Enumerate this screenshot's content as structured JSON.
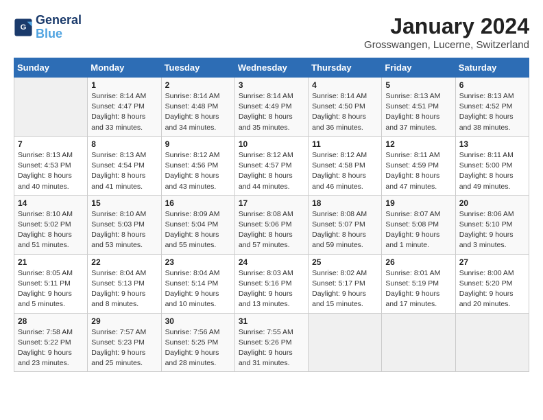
{
  "logo": {
    "line1": "General",
    "line2": "Blue"
  },
  "title": "January 2024",
  "subtitle": "Grosswangen, Lucerne, Switzerland",
  "days_of_week": [
    "Sunday",
    "Monday",
    "Tuesday",
    "Wednesday",
    "Thursday",
    "Friday",
    "Saturday"
  ],
  "weeks": [
    [
      {
        "day": "",
        "info": ""
      },
      {
        "day": "1",
        "info": "Sunrise: 8:14 AM\nSunset: 4:47 PM\nDaylight: 8 hours\nand 33 minutes."
      },
      {
        "day": "2",
        "info": "Sunrise: 8:14 AM\nSunset: 4:48 PM\nDaylight: 8 hours\nand 34 minutes."
      },
      {
        "day": "3",
        "info": "Sunrise: 8:14 AM\nSunset: 4:49 PM\nDaylight: 8 hours\nand 35 minutes."
      },
      {
        "day": "4",
        "info": "Sunrise: 8:14 AM\nSunset: 4:50 PM\nDaylight: 8 hours\nand 36 minutes."
      },
      {
        "day": "5",
        "info": "Sunrise: 8:13 AM\nSunset: 4:51 PM\nDaylight: 8 hours\nand 37 minutes."
      },
      {
        "day": "6",
        "info": "Sunrise: 8:13 AM\nSunset: 4:52 PM\nDaylight: 8 hours\nand 38 minutes."
      }
    ],
    [
      {
        "day": "7",
        "info": "Sunrise: 8:13 AM\nSunset: 4:53 PM\nDaylight: 8 hours\nand 40 minutes."
      },
      {
        "day": "8",
        "info": "Sunrise: 8:13 AM\nSunset: 4:54 PM\nDaylight: 8 hours\nand 41 minutes."
      },
      {
        "day": "9",
        "info": "Sunrise: 8:12 AM\nSunset: 4:56 PM\nDaylight: 8 hours\nand 43 minutes."
      },
      {
        "day": "10",
        "info": "Sunrise: 8:12 AM\nSunset: 4:57 PM\nDaylight: 8 hours\nand 44 minutes."
      },
      {
        "day": "11",
        "info": "Sunrise: 8:12 AM\nSunset: 4:58 PM\nDaylight: 8 hours\nand 46 minutes."
      },
      {
        "day": "12",
        "info": "Sunrise: 8:11 AM\nSunset: 4:59 PM\nDaylight: 8 hours\nand 47 minutes."
      },
      {
        "day": "13",
        "info": "Sunrise: 8:11 AM\nSunset: 5:00 PM\nDaylight: 8 hours\nand 49 minutes."
      }
    ],
    [
      {
        "day": "14",
        "info": "Sunrise: 8:10 AM\nSunset: 5:02 PM\nDaylight: 8 hours\nand 51 minutes."
      },
      {
        "day": "15",
        "info": "Sunrise: 8:10 AM\nSunset: 5:03 PM\nDaylight: 8 hours\nand 53 minutes."
      },
      {
        "day": "16",
        "info": "Sunrise: 8:09 AM\nSunset: 5:04 PM\nDaylight: 8 hours\nand 55 minutes."
      },
      {
        "day": "17",
        "info": "Sunrise: 8:08 AM\nSunset: 5:06 PM\nDaylight: 8 hours\nand 57 minutes."
      },
      {
        "day": "18",
        "info": "Sunrise: 8:08 AM\nSunset: 5:07 PM\nDaylight: 8 hours\nand 59 minutes."
      },
      {
        "day": "19",
        "info": "Sunrise: 8:07 AM\nSunset: 5:08 PM\nDaylight: 9 hours\nand 1 minute."
      },
      {
        "day": "20",
        "info": "Sunrise: 8:06 AM\nSunset: 5:10 PM\nDaylight: 9 hours\nand 3 minutes."
      }
    ],
    [
      {
        "day": "21",
        "info": "Sunrise: 8:05 AM\nSunset: 5:11 PM\nDaylight: 9 hours\nand 5 minutes."
      },
      {
        "day": "22",
        "info": "Sunrise: 8:04 AM\nSunset: 5:13 PM\nDaylight: 9 hours\nand 8 minutes."
      },
      {
        "day": "23",
        "info": "Sunrise: 8:04 AM\nSunset: 5:14 PM\nDaylight: 9 hours\nand 10 minutes."
      },
      {
        "day": "24",
        "info": "Sunrise: 8:03 AM\nSunset: 5:16 PM\nDaylight: 9 hours\nand 13 minutes."
      },
      {
        "day": "25",
        "info": "Sunrise: 8:02 AM\nSunset: 5:17 PM\nDaylight: 9 hours\nand 15 minutes."
      },
      {
        "day": "26",
        "info": "Sunrise: 8:01 AM\nSunset: 5:19 PM\nDaylight: 9 hours\nand 17 minutes."
      },
      {
        "day": "27",
        "info": "Sunrise: 8:00 AM\nSunset: 5:20 PM\nDaylight: 9 hours\nand 20 minutes."
      }
    ],
    [
      {
        "day": "28",
        "info": "Sunrise: 7:58 AM\nSunset: 5:22 PM\nDaylight: 9 hours\nand 23 minutes."
      },
      {
        "day": "29",
        "info": "Sunrise: 7:57 AM\nSunset: 5:23 PM\nDaylight: 9 hours\nand 25 minutes."
      },
      {
        "day": "30",
        "info": "Sunrise: 7:56 AM\nSunset: 5:25 PM\nDaylight: 9 hours\nand 28 minutes."
      },
      {
        "day": "31",
        "info": "Sunrise: 7:55 AM\nSunset: 5:26 PM\nDaylight: 9 hours\nand 31 minutes."
      },
      {
        "day": "",
        "info": ""
      },
      {
        "day": "",
        "info": ""
      },
      {
        "day": "",
        "info": ""
      }
    ]
  ]
}
